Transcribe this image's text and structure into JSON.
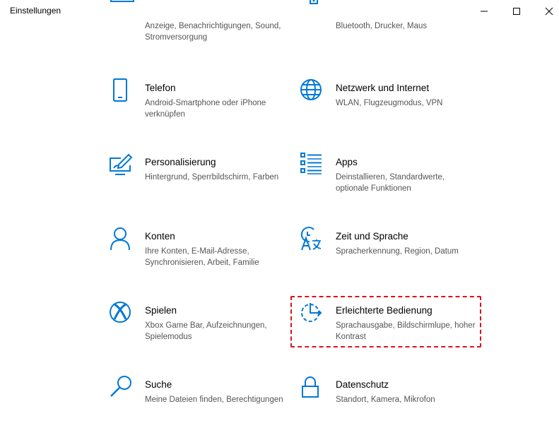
{
  "window": {
    "title": "Einstellungen"
  },
  "accent_color": "#0078d7",
  "highlight_color": "#d8141c",
  "items": [
    {
      "icon": "display-icon",
      "name": "",
      "desc": "Anzeige, Benachrichtigungen, Sound, Stromversorgung"
    },
    {
      "icon": "devices-icon",
      "name": "",
      "desc": "Bluetooth, Drucker, Maus"
    },
    {
      "icon": "phone-icon",
      "name": "Telefon",
      "desc": "Android-Smartphone oder iPhone verknüpfen"
    },
    {
      "icon": "globe-icon",
      "name": "Netzwerk und Internet",
      "desc": "WLAN, Flugzeugmodus, VPN"
    },
    {
      "icon": "personalization-icon",
      "name": "Personalisierung",
      "desc": "Hintergrund, Sperrbildschirm, Farben"
    },
    {
      "icon": "apps-icon",
      "name": "Apps",
      "desc": "Deinstallieren, Standardwerte, optionale Funktionen"
    },
    {
      "icon": "person-icon",
      "name": "Konten",
      "desc": "Ihre Konten, E-Mail-Adresse, Synchronisieren, Arbeit, Familie"
    },
    {
      "icon": "time-language-icon",
      "name": "Zeit und Sprache",
      "desc": "Spracherkennung, Region, Datum"
    },
    {
      "icon": "xbox-icon",
      "name": "Spielen",
      "desc": "Xbox Game Bar, Aufzeichnungen, Spielemodus"
    },
    {
      "icon": "ease-of-access-icon",
      "name": "Erleichterte Bedienung",
      "desc": "Sprachausgabe, Bildschirmlupe, hoher Kontrast"
    },
    {
      "icon": "search-icon",
      "name": "Suche",
      "desc": "Meine Dateien finden, Berechtigungen"
    },
    {
      "icon": "lock-icon",
      "name": "Datenschutz",
      "desc": "Standort, Kamera, Mikrofon"
    }
  ]
}
